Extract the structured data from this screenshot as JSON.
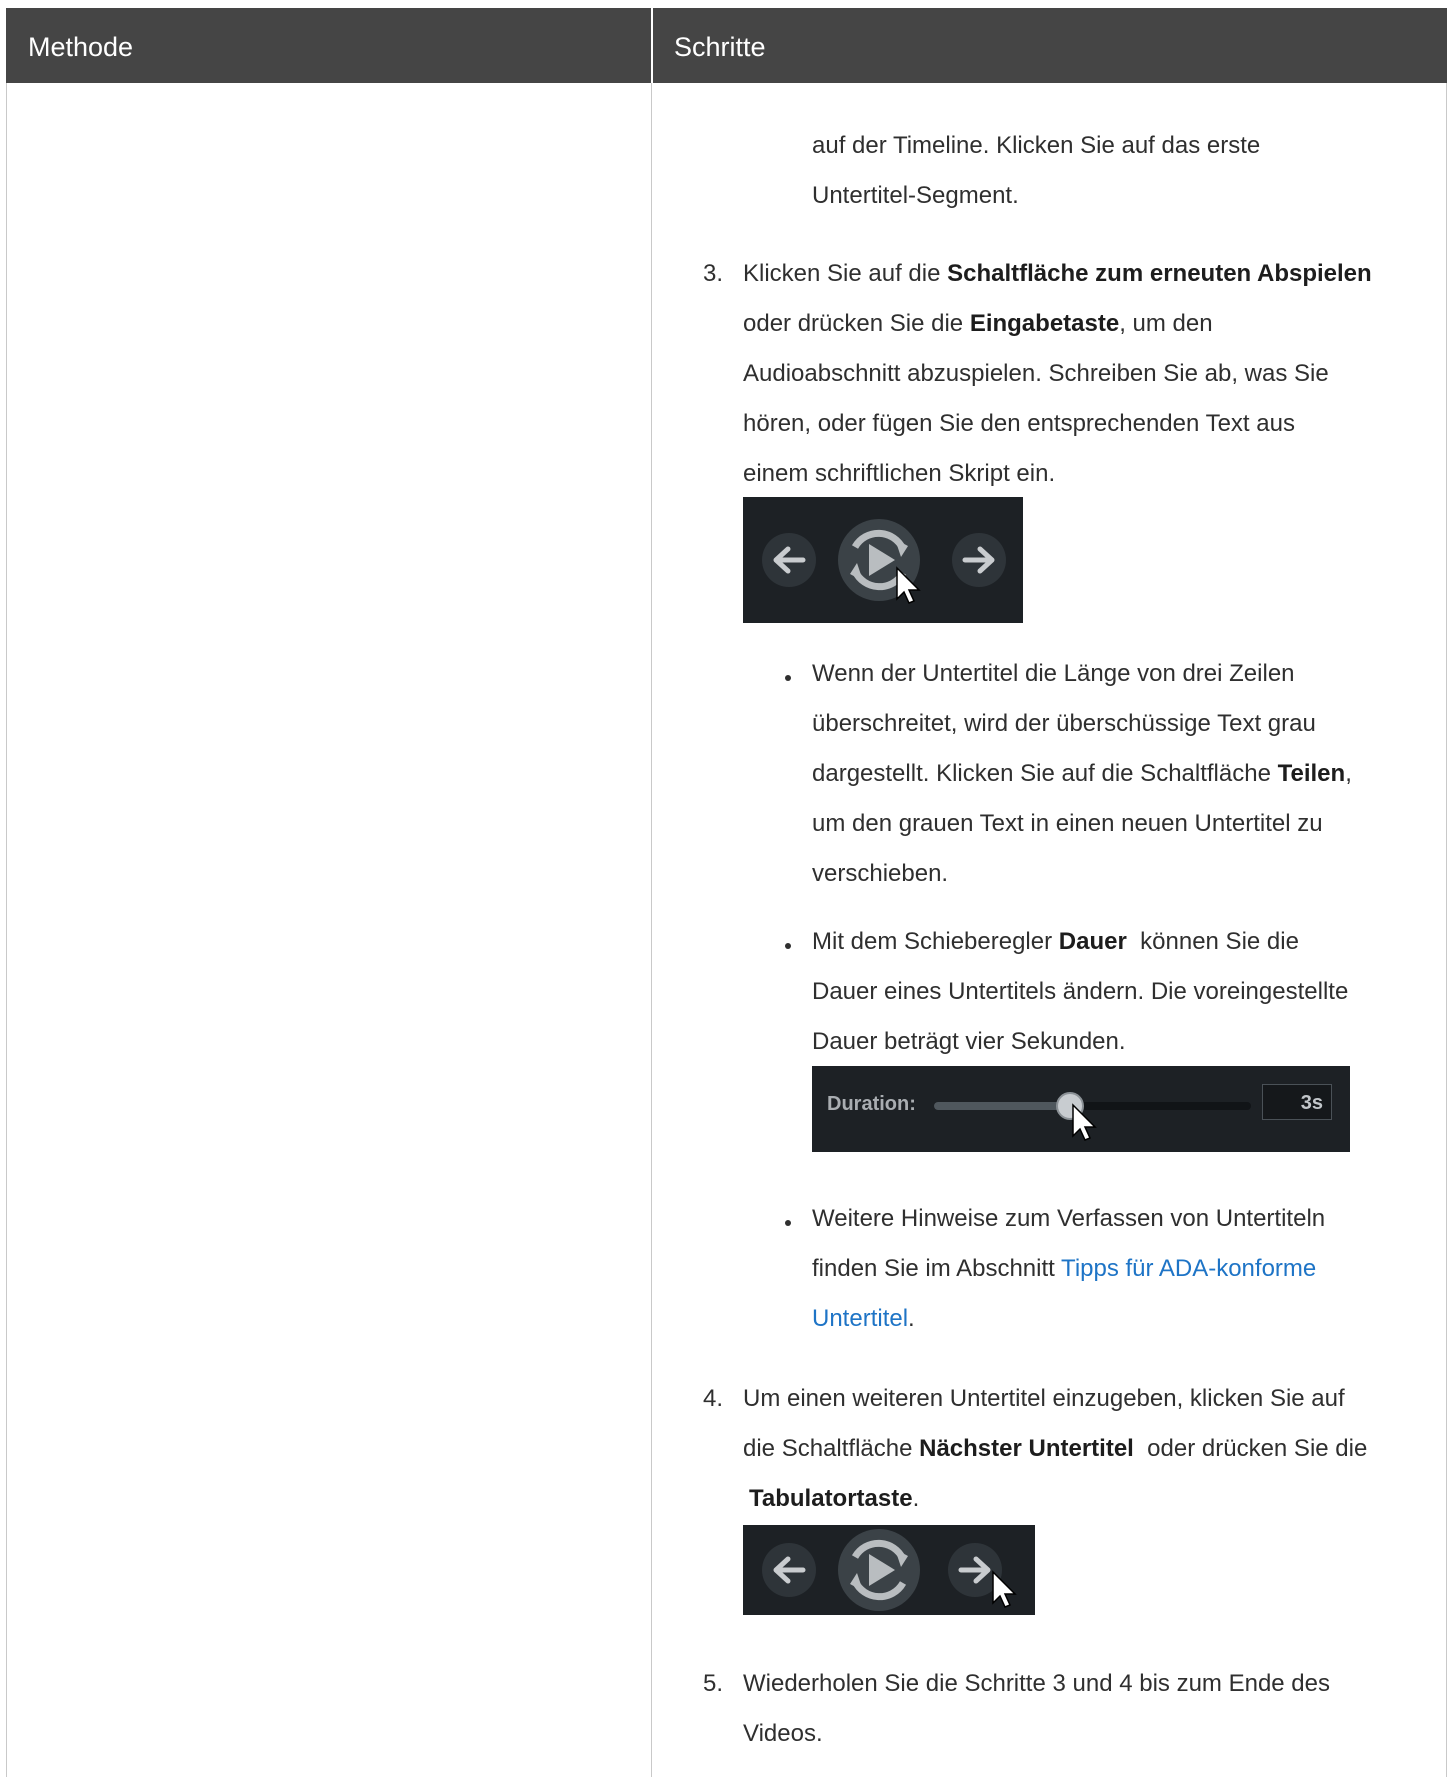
{
  "header": {
    "col1": "Methode",
    "col2": "Schritte"
  },
  "intro": {
    "line1": "auf der Timeline. Klicken Sie auf das erste",
    "line2": "Untertitel-Segment."
  },
  "step3": {
    "number": "3.",
    "l1_a": "Klicken Sie auf die ",
    "l1_b": "Schaltfläche zum erneuten Abspielen",
    "l2_a": "oder drücken Sie die ",
    "l2_b": "Eingabetaste",
    "l2_c": ", um den",
    "l3": "Audioabschnitt abzuspielen. Schreiben Sie ab, was Sie",
    "l4": "hören, oder fügen Sie den entsprechenden Text aus",
    "l5": "einem schriftlichen Skript ein."
  },
  "bullet1": {
    "l1": "Wenn der Untertitel die Länge von drei Zeilen",
    "l2": "überschreitet, wird der überschüssige Text grau",
    "l3_a": "dargestellt. Klicken Sie auf die Schaltfläche ",
    "l3_b": "Teilen",
    "l3_c": ",",
    "l4": "um den grauen Text in einen neuen Untertitel zu",
    "l5": "verschieben."
  },
  "bullet2": {
    "l1_a": "Mit dem Schieberegler ",
    "l1_b": "Dauer",
    "l1_c": "  können Sie die",
    "l2": "Dauer eines Untertitels ändern. Die voreingestellte",
    "l3": "Dauer beträgt vier Sekunden."
  },
  "duration_widget": {
    "label": "Duration:",
    "value": "3s",
    "slider_fraction": 0.43
  },
  "bullet3": {
    "l1": "Weitere Hinweise zum Verfassen von Untertiteln",
    "l2_a": "finden Sie im Abschnitt ",
    "l2_link": "Tipps für ADA-konforme",
    "l3_link": "Untertitel",
    "l3_c": "."
  },
  "step4": {
    "number": "4.",
    "l1": "Um einen weiteren Untertitel einzugeben, klicken Sie auf",
    "l2_a": "die Schaltfläche ",
    "l2_b": "Nächster Untertitel",
    "l2_c": "  oder drücken Sie die",
    "l3_b": "Tabulatortaste",
    "l3_c": "."
  },
  "step5": {
    "number": "5.",
    "l1": "Wiederholen Sie die Schritte 3 und 4 bis zum Ende des",
    "l2": "Videos."
  },
  "colors": {
    "header_bg": "#454545",
    "link": "#1e74c6",
    "screenshot_bg": "#1d2125"
  },
  "icons": [
    "arrow-left-icon",
    "replay-icon",
    "arrow-right-icon",
    "cursor-icon"
  ]
}
